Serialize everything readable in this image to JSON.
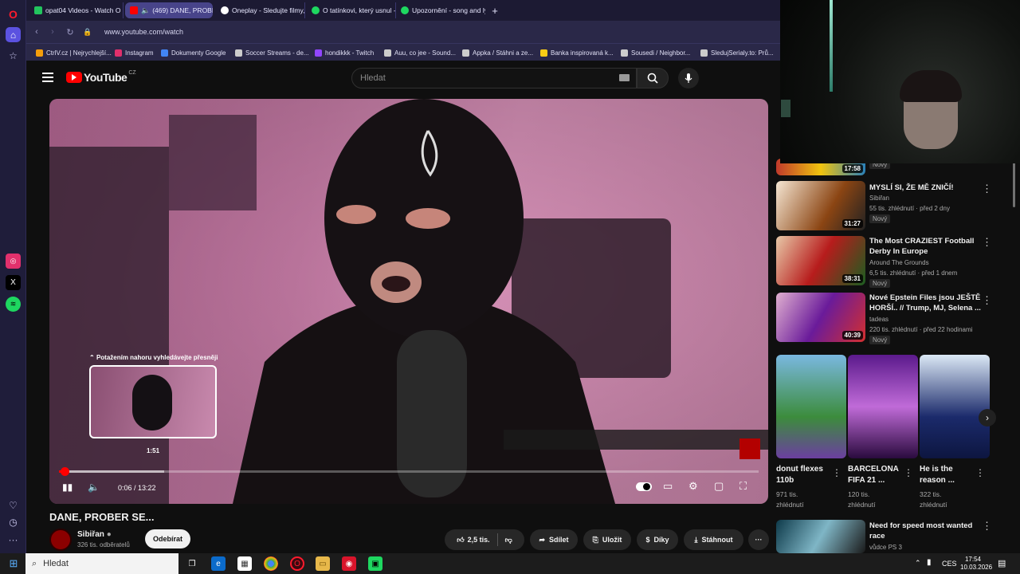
{
  "tabs": [
    {
      "label": "opat04 Videos - Watch O",
      "fav": "#22c55e"
    },
    {
      "label": "(469) DANE, PROBER",
      "fav": "#ff0000",
      "muted": true
    },
    {
      "label": "Oneplay - Sledujte filmy, s",
      "fav": "#ffffff"
    },
    {
      "label": "O tatínkovi, který usnul - /",
      "fav": "#1ed760"
    },
    {
      "label": "Upozornění - song and ly",
      "fav": "#1ed760"
    }
  ],
  "address": {
    "url": "www.youtube.com/watch"
  },
  "bookmarks": [
    {
      "label": "CtrlV.cz | Nejrychlejší...",
      "fav": "#f59e0b"
    },
    {
      "label": "Instagram",
      "fav": "#e1306c"
    },
    {
      "label": "Dokumenty Google",
      "fav": "#4285f4"
    },
    {
      "label": "Soccer Streams - de...",
      "fav": "#cccccc"
    },
    {
      "label": "hondikkk - Twitch",
      "fav": "#9146ff"
    },
    {
      "label": "Auu, co jee - Sound...",
      "fav": "#cccccc"
    },
    {
      "label": "Appka / Stáhni a ze...",
      "fav": "#cccccc"
    },
    {
      "label": "Banka inspirovaná k...",
      "fav": "#facc15"
    },
    {
      "label": "Sousedi / Neighbor...",
      "fav": "#cccccc"
    },
    {
      "label": "SledujSerialy.to: Prů...",
      "fav": "#cccccc"
    }
  ],
  "youtube": {
    "logo": "YouTube",
    "country": "CZ",
    "search_placeholder": "Hledat",
    "player": {
      "seek_hint": "Potažením nahoru vyhledávejte přesněji",
      "preview_time": "1:51",
      "time": "0:06 / 13:22",
      "progress_fraction": 0.008,
      "buffer_fraction": 0.15
    },
    "video_title": "DANE, PROBER SE...",
    "channel": {
      "name": "Sibiřan",
      "subs": "326 tis. odběratelů",
      "subscribe_label": "Odebírat"
    },
    "actions": {
      "likes": "2,5 tis.",
      "share": "Sdílet",
      "save": "Uložit",
      "thanks": "Díky",
      "download": "Stáhnout"
    },
    "recommendations": [
      {
        "duration": "17:58",
        "title": "",
        "channel": "",
        "meta": "",
        "badge": "Nový"
      },
      {
        "duration": "31:27",
        "title": "MYSLÍ SI, ŽE MĚ ZNIČÍ!",
        "channel": "Sibiřan",
        "meta": "55 tis. zhlédnutí · před 2 dny",
        "badge": "Nový"
      },
      {
        "duration": "38:31",
        "title": "The Most CRAZIEST Football Derby In Europe",
        "channel": "Around The Grounds",
        "meta": "6,5 tis. zhlédnutí · před 1 dnem",
        "badge": "Nový"
      },
      {
        "duration": "40:39",
        "title": "Nové Epstein Files jsou JEŠTĚ HORŠÍ.. // Trump, MJ, Selena ...",
        "channel": "tadeas",
        "meta": "220 tis. zhlédnutí · před 22 hodinami",
        "badge": "Nový"
      }
    ],
    "shorts": [
      {
        "title": "donut flexes 110b",
        "views": "971 tis. zhlédnutí"
      },
      {
        "title": "BARCELONA FIFA 21 ...",
        "views": "120 tis. zhlédnutí"
      },
      {
        "title": "He is the reason ...",
        "views": "322 tis. zhlédnutí"
      }
    ],
    "bottom_rec": {
      "title": "Need for speed most wanted race",
      "channel": "vůdce PS 3"
    }
  },
  "taskbar": {
    "search": "Hledat",
    "lang": "CES",
    "time": "17:54",
    "date": "10.03.2026"
  }
}
